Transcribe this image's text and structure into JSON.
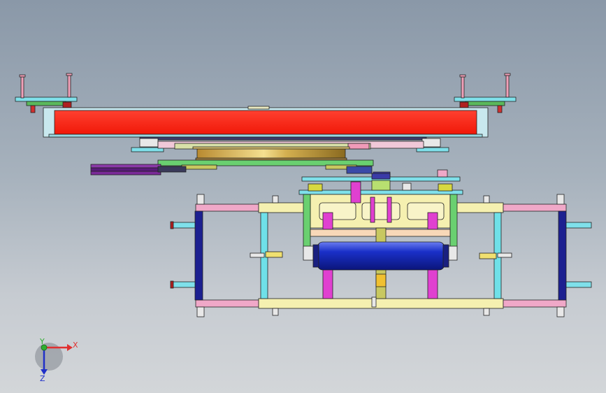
{
  "triad": {
    "x_label": "X",
    "y_label": "Y",
    "z_label": "Z",
    "x_color": "#e03030",
    "y_color": "#2fae2f",
    "z_color": "#2030c8"
  },
  "colors": {
    "background_top": "#8a98a8",
    "background_bottom": "#d3d6d9",
    "red_platform": "#ff2a1a",
    "frame_teal": "#6fe0e8",
    "frame_yellow": "#f5f0b0",
    "frame_pink": "#f0a8c8",
    "frame_navy": "#1c2090",
    "roller_blue": "#1a30c8",
    "magenta": "#e040d0",
    "green_plate": "#6ad070",
    "olive": "#c8c860",
    "purple": "#6a2a8a",
    "gold": "#d8b040"
  }
}
